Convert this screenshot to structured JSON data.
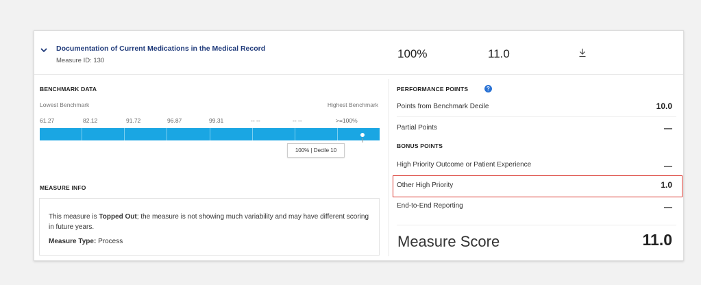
{
  "measure": {
    "title": "Documentation of Current Medications in the Medical Record",
    "id_text": "Measure ID: 130",
    "performance_rate": "100%",
    "score_header": "11.0"
  },
  "benchmark": {
    "section_label": "BENCHMARK DATA",
    "lowest_label": "Lowest Benchmark",
    "highest_label": "Highest Benchmark",
    "ticks": [
      "61.27",
      "82.12",
      "91.72",
      "96.87",
      "99.31",
      "-- --",
      "-- --",
      ">=100%"
    ],
    "marker_tooltip": "100% | Decile 10",
    "decile_position": 0.95,
    "bar_color": "#1aa6e3"
  },
  "measure_info": {
    "section_label": "MEASURE INFO",
    "text_prefix": "This measure is ",
    "text_strong": "Topped Out",
    "text_suffix": "; the measure is not showing much variability and may have different scoring in future years.",
    "type_label": "Measure Type:",
    "type_value": " Process"
  },
  "points": {
    "section_label": "PERFORMANCE POINTS",
    "help_glyph": "?",
    "rows": [
      {
        "label": "Points from Benchmark Decile",
        "value": "10.0"
      },
      {
        "label": "Partial Points",
        "value": "—"
      }
    ],
    "bonus_label": "BONUS POINTS",
    "bonus_rows": [
      {
        "label": "High Priority Outcome or Patient Experience",
        "value": "—"
      },
      {
        "label": "Other High Priority",
        "value": "1.0"
      },
      {
        "label": "End-to-End Reporting",
        "value": "—"
      }
    ],
    "highlight_color": "#d9342b"
  },
  "score": {
    "label": "Measure Score",
    "value": "11.0"
  },
  "icons": {
    "expand": "chevron-down-icon",
    "download": "download-icon",
    "help": "help-icon"
  }
}
